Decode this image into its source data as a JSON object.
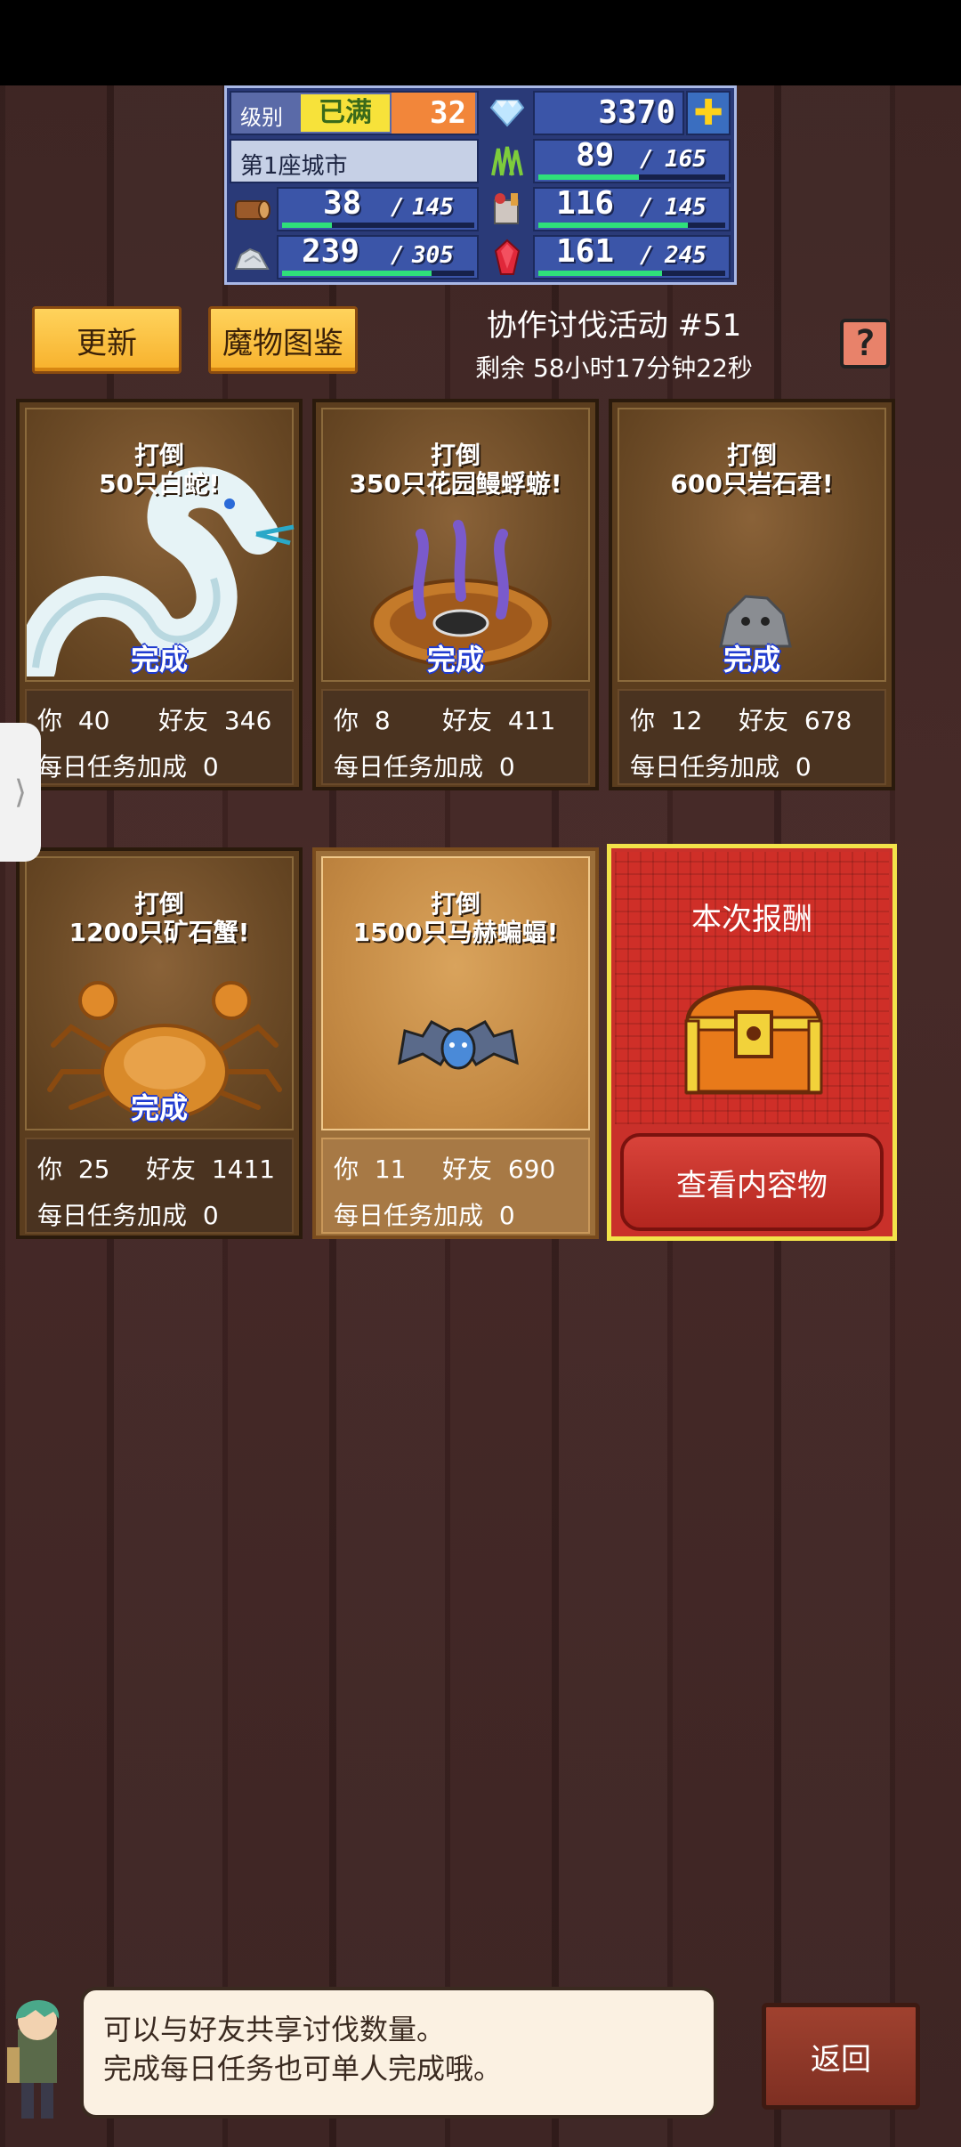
{
  "resources": {
    "level_label": "级别",
    "level_badge": "已满",
    "level_value": "32",
    "gems": "3370",
    "city_label": "第1座城市",
    "row2_right": {
      "value": "89",
      "max": "165",
      "fill": 0.54,
      "icon": "grass-icon"
    },
    "row3_left": {
      "value": "38",
      "max": "145",
      "fill": 0.26,
      "icon": "wood-log-icon"
    },
    "row3_right": {
      "value": "116",
      "max": "145",
      "fill": 0.8,
      "icon": "food-icon"
    },
    "row4_left": {
      "value": "239",
      "max": "305",
      "fill": 0.78,
      "icon": "stone-icon"
    },
    "row4_right": {
      "value": "161",
      "max": "245",
      "fill": 0.66,
      "icon": "ruby-icon"
    },
    "slash": "/",
    "plus_symbol": "✚"
  },
  "header": {
    "refresh_label": "更新",
    "bestiary_label": "魔物图鉴",
    "event_title": "协作讨伐活动 #51",
    "remaining": "剩余 58小时17分钟22秒",
    "help_symbol": "?"
  },
  "cards": [
    {
      "title1": "打倒",
      "title2": "50只白蛇!",
      "complete": "完成",
      "you_label": "你",
      "you": "40",
      "friends_label": "好友",
      "friends": "346",
      "bonus_label": "每日任务加成",
      "bonus": "0"
    },
    {
      "title1": "打倒",
      "title2": "350只花园鳗蜉蝣!",
      "complete": "完成",
      "you_label": "你",
      "you": "8",
      "friends_label": "好友",
      "friends": "411",
      "bonus_label": "每日任务加成",
      "bonus": "0"
    },
    {
      "title1": "打倒",
      "title2": "600只岩石君!",
      "complete": "完成",
      "you_label": "你",
      "you": "12",
      "friends_label": "好友",
      "friends": "678",
      "bonus_label": "每日任务加成",
      "bonus": "0"
    },
    {
      "title1": "打倒",
      "title2": "1200只矿石蟹!",
      "complete": "完成",
      "you_label": "你",
      "you": "25",
      "friends_label": "好友",
      "friends": "1411",
      "bonus_label": "每日任务加成",
      "bonus": "0"
    },
    {
      "title1": "打倒",
      "title2": "1500只马赫蝙蝠!",
      "complete": "",
      "you_label": "你",
      "you": "11",
      "friends_label": "好友",
      "friends": "690",
      "bonus_label": "每日任务加成",
      "bonus": "0"
    }
  ],
  "reward": {
    "title": "本次报酬",
    "button": "查看内容物"
  },
  "side_tab_symbol": "⟩",
  "message": {
    "line1": "可以与好友共享讨伐数量。",
    "line2": "完成每日任务也可单人完成哦。"
  },
  "back_label": "返回"
}
